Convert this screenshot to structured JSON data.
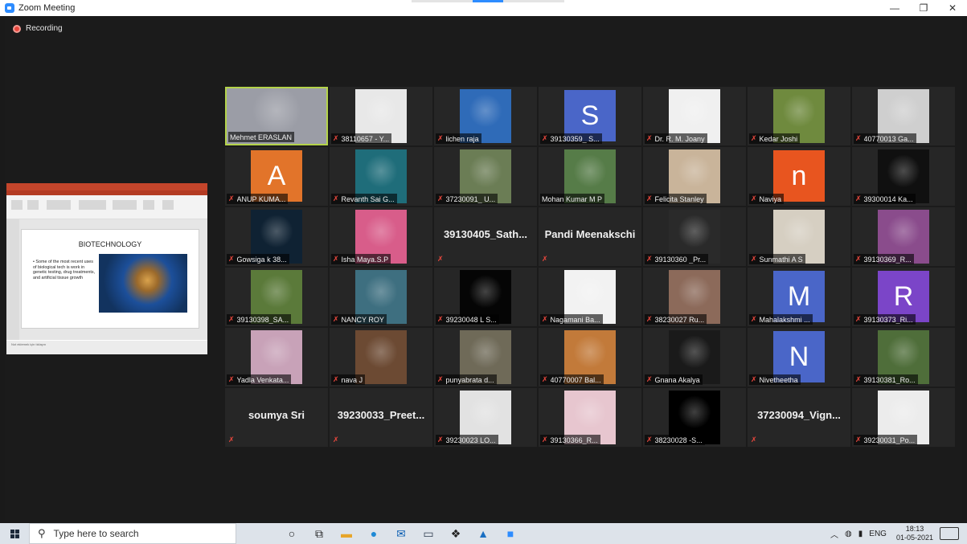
{
  "window": {
    "title": "Zoom Meeting",
    "minimize": "—",
    "maximize": "❐",
    "close": "✕"
  },
  "meeting": {
    "recording_label": "Recording"
  },
  "share": {
    "slide_title": "BIOTECHNOLOGY",
    "slide_text": "• Some of the most recent uses of biological tech is work in genetic testing, drug treatments, and artificial tissue growth",
    "notes_text": "Not eklemek için tıklayın"
  },
  "participants": [
    [
      {
        "name": "Mehmet ERASLAN",
        "muted": false,
        "active": true,
        "kind": "photo",
        "bg": "#9b9da6"
      },
      {
        "name": "38110657 - Y...",
        "muted": true,
        "kind": "photo",
        "bg": "#e8e8e8"
      },
      {
        "name": "lichen raja",
        "muted": true,
        "kind": "photo",
        "bg": "#2f6bb8"
      },
      {
        "name": "39130359_ S...",
        "muted": true,
        "kind": "avatar",
        "letter": "S",
        "bg": "#4a66c8"
      },
      {
        "name": "Dr. R. M. Joany",
        "muted": true,
        "kind": "photo",
        "bg": "#f0f0f0"
      },
      {
        "name": "Kedar Joshi",
        "muted": true,
        "kind": "photo",
        "bg": "#6f8a3e"
      },
      {
        "name": "40770013 Ga...",
        "muted": true,
        "kind": "photo",
        "bg": "#cfcfcf"
      }
    ],
    [
      {
        "name": "ANUP KUMA...",
        "muted": true,
        "kind": "avatar",
        "letter": "A",
        "bg": "#e2742a"
      },
      {
        "name": "Revanth Sai G...",
        "muted": true,
        "kind": "photo",
        "bg": "#1f6d7a"
      },
      {
        "name": "37230091_ U...",
        "muted": true,
        "kind": "photo",
        "bg": "#6b7d55"
      },
      {
        "name": "Mohan Kumar M P",
        "muted": false,
        "kind": "photo",
        "bg": "#567c48"
      },
      {
        "name": "Felicita Stanley",
        "muted": true,
        "kind": "photo",
        "bg": "#c9b49a"
      },
      {
        "name": "Naviya",
        "muted": true,
        "kind": "avatar",
        "letter": "n",
        "bg": "#e8551f"
      },
      {
        "name": "39300014 Ka...",
        "muted": true,
        "kind": "photo",
        "bg": "#101010"
      }
    ],
    [
      {
        "name": "Gowsiga k 38...",
        "muted": true,
        "kind": "photo",
        "bg": "#0f2233"
      },
      {
        "name": "Isha Maya.S.P",
        "muted": true,
        "kind": "photo",
        "bg": "#d85d8a"
      },
      {
        "name": "",
        "muted": true,
        "kind": "text",
        "big": "39130405_Sath..."
      },
      {
        "name": "",
        "muted": true,
        "kind": "text",
        "big": "Pandi Meenakschi"
      },
      {
        "name": "39130360 _Pr...",
        "muted": true,
        "kind": "photo",
        "bg": "#2a2a2a"
      },
      {
        "name": "Sunmathi A S",
        "muted": true,
        "kind": "photo",
        "bg": "#d6cfc2"
      },
      {
        "name": "39130369_R...",
        "muted": true,
        "kind": "photo",
        "bg": "#8a4c8c"
      }
    ],
    [
      {
        "name": "39130398_SA...",
        "muted": true,
        "kind": "photo",
        "bg": "#5b7a3a"
      },
      {
        "name": "NANCY ROY",
        "muted": true,
        "kind": "photo",
        "bg": "#3e6f80"
      },
      {
        "name": "39230048 L S...",
        "muted": true,
        "kind": "photo",
        "bg": "#050505"
      },
      {
        "name": "Nagamani Ba...",
        "muted": true,
        "kind": "photo",
        "bg": "#f2f2f2"
      },
      {
        "name": "38230027 Ru...",
        "muted": true,
        "kind": "photo",
        "bg": "#8c6a5a"
      },
      {
        "name": "Mahalakshmi ...",
        "muted": true,
        "kind": "avatar",
        "letter": "M",
        "bg": "#4a66c8"
      },
      {
        "name": "39130373_Ri...",
        "muted": true,
        "kind": "avatar",
        "letter": "R",
        "bg": "#7b45c8"
      }
    ],
    [
      {
        "name": "Yadla Venkata...",
        "muted": true,
        "kind": "photo",
        "bg": "#c8a2b8"
      },
      {
        "name": "nava J",
        "muted": true,
        "kind": "photo",
        "bg": "#6c4a33"
      },
      {
        "name": "punyabrata d...",
        "muted": true,
        "kind": "photo",
        "bg": "#6f6a58"
      },
      {
        "name": "40770007 Bal...",
        "muted": true,
        "kind": "photo",
        "bg": "#c27a3a"
      },
      {
        "name": "Gnana Akalya",
        "muted": true,
        "kind": "photo",
        "bg": "#1a1a1a"
      },
      {
        "name": "Nivetheetha",
        "muted": true,
        "kind": "avatar",
        "letter": "N",
        "bg": "#4a66c8"
      },
      {
        "name": "39130381_Ro...",
        "muted": true,
        "kind": "photo",
        "bg": "#4f6e3a"
      }
    ],
    [
      {
        "name": "",
        "muted": true,
        "kind": "text",
        "big": "soumya Sri"
      },
      {
        "name": "",
        "muted": true,
        "kind": "text",
        "big": "39230033_Preet..."
      },
      {
        "name": "39230023 LO...",
        "muted": true,
        "kind": "photo",
        "bg": "#e2e2e2"
      },
      {
        "name": "39130366_R...",
        "muted": true,
        "kind": "photo",
        "bg": "#e7c6cf"
      },
      {
        "name": "38230028 -S...",
        "muted": true,
        "kind": "photo",
        "bg": "#000000"
      },
      {
        "name": "",
        "muted": true,
        "kind": "text",
        "big": "37230094_Vign..."
      },
      {
        "name": "39230031_Po...",
        "muted": true,
        "kind": "photo",
        "bg": "#ececec"
      }
    ]
  ],
  "taskbar": {
    "search_placeholder": "Type here to search",
    "lang": "ENG",
    "time": "18:13",
    "date": "01-05-2021"
  }
}
